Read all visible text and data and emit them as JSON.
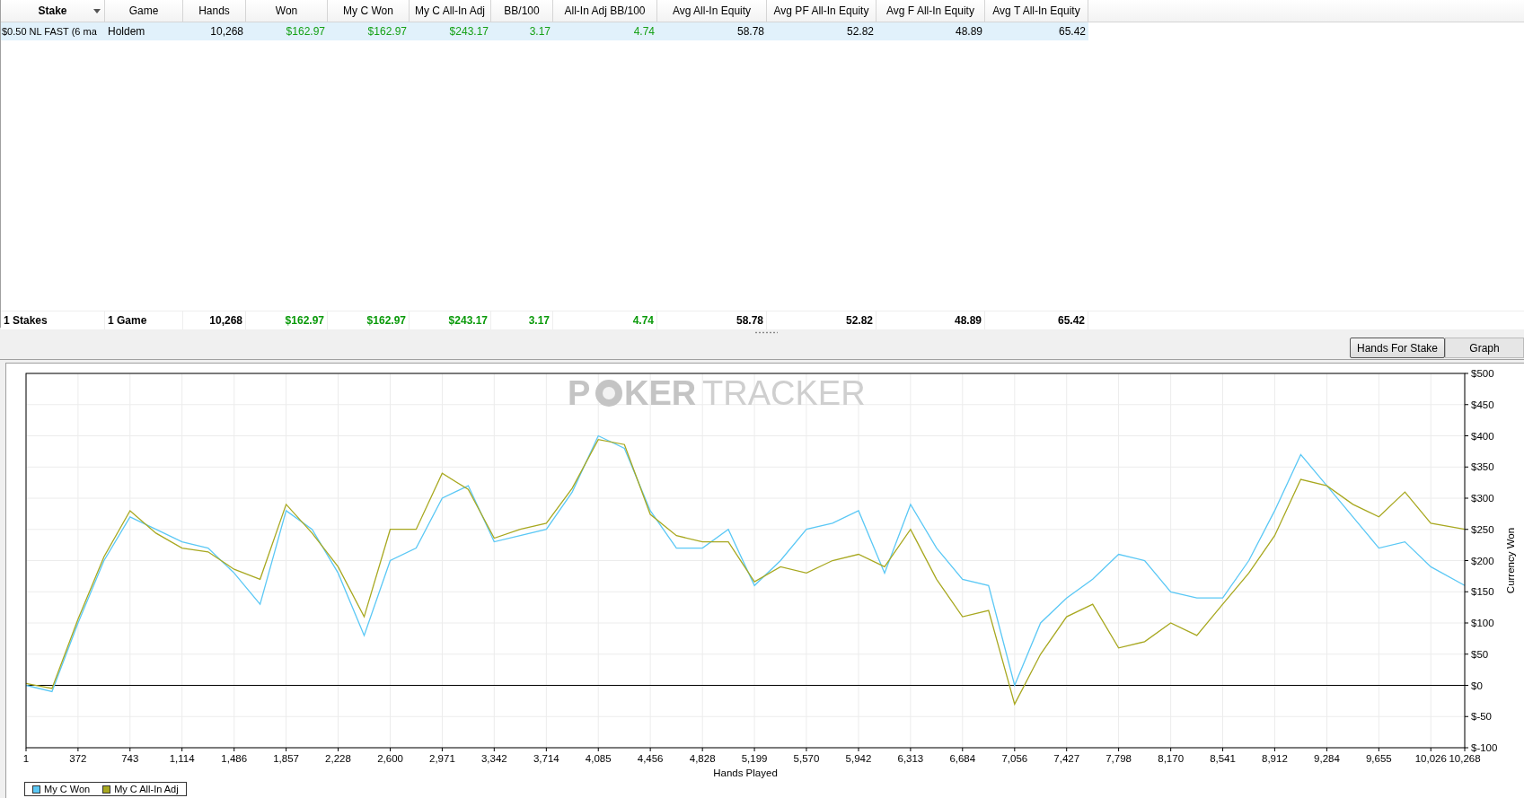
{
  "table": {
    "columns": [
      {
        "label": "Stake",
        "kind": "text",
        "sorted": true
      },
      {
        "label": "Game",
        "kind": "text",
        "sorted": false
      },
      {
        "label": "Hands",
        "kind": "number",
        "sorted": false
      },
      {
        "label": "Won",
        "kind": "result",
        "sorted": false
      },
      {
        "label": "My C Won",
        "kind": "result",
        "sorted": false
      },
      {
        "label": "My C All-In Adj",
        "kind": "result",
        "sorted": false
      },
      {
        "label": "BB/100",
        "kind": "result",
        "sorted": false
      },
      {
        "label": "All-In Adj BB/100",
        "kind": "result",
        "sorted": false
      },
      {
        "label": "Avg All-In Equity",
        "kind": "number",
        "sorted": false
      },
      {
        "label": "Avg PF All-In Equity",
        "kind": "number",
        "sorted": false
      },
      {
        "label": "Avg F All-In Equity",
        "kind": "number",
        "sorted": false
      },
      {
        "label": "Avg T All-In Equity",
        "kind": "number",
        "sorted": false
      }
    ],
    "rows": [
      {
        "selected": true,
        "cells": [
          "$0.50 NL FAST (6 ma",
          "Holdem",
          "10,268",
          "$162.97",
          "$162.97",
          "$243.17",
          "3.17",
          "4.74",
          "58.78",
          "52.82",
          "48.89",
          "65.42"
        ]
      }
    ],
    "totals": [
      "1 Stakes",
      "1 Game",
      "10,268",
      "$162.97",
      "$162.97",
      "$243.17",
      "3.17",
      "4.74",
      "58.78",
      "52.82",
      "48.89",
      "65.42"
    ]
  },
  "tabs": [
    {
      "label": "Hands For Stake",
      "selected": true
    },
    {
      "label": "Graph",
      "selected": false
    }
  ],
  "chart": {
    "watermark": {
      "before_chip": "P",
      "after_chip": "KER",
      "second": "TRACKER"
    },
    "chart_data": {
      "type": "line",
      "grid": true,
      "xlabel": "Hands Played",
      "ylabel": "Currency Won",
      "xlim": [
        1,
        10268
      ],
      "ylim": [
        -100,
        500
      ],
      "x": [
        1,
        186,
        372,
        557,
        743,
        928,
        1114,
        1300,
        1486,
        1671,
        1857,
        2042,
        2228,
        2414,
        2600,
        2785,
        2971,
        3157,
        3342,
        3528,
        3714,
        3899,
        4085,
        4271,
        4456,
        4642,
        4828,
        5013,
        5199,
        5385,
        5570,
        5756,
        5942,
        6128,
        6313,
        6499,
        6684,
        6870,
        7056,
        7241,
        7427,
        7613,
        7798,
        7984,
        8170,
        8356,
        8541,
        8727,
        8912,
        9098,
        9284,
        9470,
        9655,
        9841,
        10026,
        10268
      ],
      "series": [
        {
          "name": "My C Won",
          "color": "#5bc8f5",
          "values": [
            0,
            -10,
            100,
            200,
            270,
            250,
            230,
            220,
            180,
            130,
            280,
            250,
            180,
            80,
            200,
            220,
            300,
            320,
            230,
            240,
            250,
            310,
            400,
            380,
            280,
            220,
            220,
            250,
            160,
            200,
            250,
            260,
            280,
            180,
            290,
            220,
            170,
            160,
            0,
            100,
            140,
            170,
            210,
            200,
            150,
            140,
            140,
            200,
            280,
            370,
            320,
            270,
            220,
            230,
            190,
            160
          ]
        },
        {
          "name": "My C All-In Adj",
          "color": "#a8a820",
          "values": [
            3,
            -5,
            106,
            206,
            280,
            244,
            220,
            214,
            186,
            170,
            290,
            244,
            190,
            110,
            250,
            250,
            340,
            314,
            236,
            250,
            260,
            316,
            394,
            386,
            274,
            240,
            230,
            230,
            166,
            190,
            180,
            200,
            210,
            190,
            250,
            170,
            110,
            120,
            -30,
            50,
            110,
            130,
            60,
            70,
            100,
            80,
            130,
            180,
            240,
            330,
            320,
            290,
            270,
            310,
            260,
            250
          ]
        }
      ],
      "xticks": [
        {
          "value": 1,
          "label": "1"
        },
        {
          "value": 372,
          "label": "372"
        },
        {
          "value": 743,
          "label": "743"
        },
        {
          "value": 1114,
          "label": "1,114"
        },
        {
          "value": 1486,
          "label": "1,486"
        },
        {
          "value": 1857,
          "label": "1,857"
        },
        {
          "value": 2228,
          "label": "2,228"
        },
        {
          "value": 2600,
          "label": "2,600"
        },
        {
          "value": 2971,
          "label": "2,971"
        },
        {
          "value": 3342,
          "label": "3,342"
        },
        {
          "value": 3714,
          "label": "3,714"
        },
        {
          "value": 4085,
          "label": "4,085"
        },
        {
          "value": 4456,
          "label": "4,456"
        },
        {
          "value": 4828,
          "label": "4,828"
        },
        {
          "value": 5199,
          "label": "5,199"
        },
        {
          "value": 5570,
          "label": "5,570"
        },
        {
          "value": 5942,
          "label": "5,942"
        },
        {
          "value": 6313,
          "label": "6,313"
        },
        {
          "value": 6684,
          "label": "6,684"
        },
        {
          "value": 7056,
          "label": "7,056"
        },
        {
          "value": 7427,
          "label": "7,427"
        },
        {
          "value": 7798,
          "label": "7,798"
        },
        {
          "value": 8170,
          "label": "8,170"
        },
        {
          "value": 8541,
          "label": "8,541"
        },
        {
          "value": 8912,
          "label": "8,912"
        },
        {
          "value": 9284,
          "label": "9,284"
        },
        {
          "value": 9655,
          "label": "9,655"
        },
        {
          "value": 10026,
          "label": "10,026"
        },
        {
          "value": 10268,
          "label": "10,268"
        }
      ],
      "yticks": [
        {
          "value": 500,
          "label": "$500"
        },
        {
          "value": 450,
          "label": "$450"
        },
        {
          "value": 400,
          "label": "$400"
        },
        {
          "value": 350,
          "label": "$350"
        },
        {
          "value": 300,
          "label": "$300"
        },
        {
          "value": 250,
          "label": "$250"
        },
        {
          "value": 200,
          "label": "$200"
        },
        {
          "value": 150,
          "label": "$150"
        },
        {
          "value": 100,
          "label": "$100"
        },
        {
          "value": 50,
          "label": "$50"
        },
        {
          "value": 0,
          "label": "$0"
        },
        {
          "value": -50,
          "label": "$-50"
        },
        {
          "value": -100,
          "label": "$-100"
        }
      ]
    }
  }
}
